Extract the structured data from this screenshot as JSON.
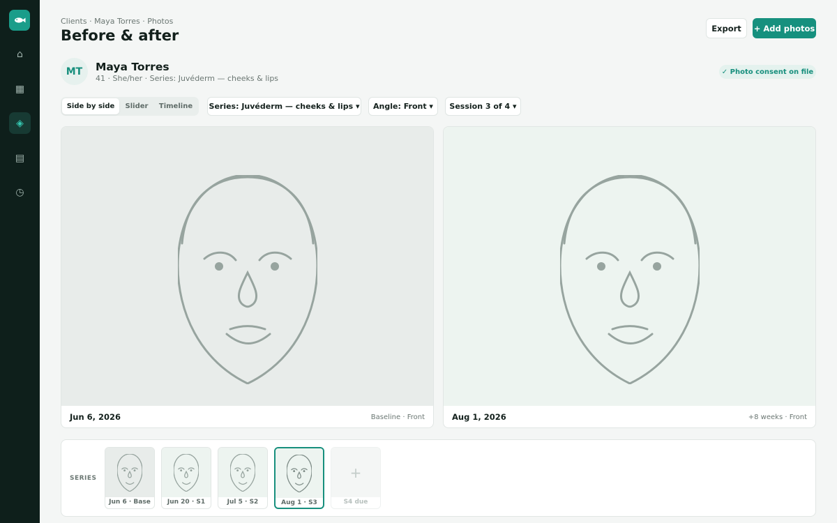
{
  "nav": {
    "logo": "fish-logo",
    "items": [
      {
        "icon": "home-icon",
        "glyph": "⌂"
      },
      {
        "icon": "calendar-icon",
        "glyph": "▦"
      },
      {
        "icon": "photos-icon",
        "glyph": "◈"
      },
      {
        "icon": "records-icon",
        "glyph": "▤"
      },
      {
        "icon": "history-icon",
        "glyph": "◷"
      }
    ],
    "active_index": 2
  },
  "header": {
    "breadcrumb": "Clients · Maya Torres · Photos",
    "title": "Before & after",
    "export_label": "Export",
    "add_label": "+ Add photos"
  },
  "client": {
    "initials": "MT",
    "name": "Maya Torres",
    "meta": "41 · She/her · Series: Juvéderm — cheeks & lips",
    "consent": "✓ Photo consent on file"
  },
  "view_modes": [
    "Side by side",
    "Slider",
    "Timeline"
  ],
  "active_view": "Side by side",
  "filters": {
    "series": "Series: Juvéderm — cheeks & lips ▾",
    "angle": "Angle: Front ▾",
    "session": "Session 3 of 4 ▾"
  },
  "before": {
    "date": "Jun 6, 2026",
    "note": "Baseline · Front"
  },
  "after": {
    "date": "Aug 1, 2026",
    "note": "+8 weeks · Front"
  },
  "series_strip": {
    "label": "SERIES",
    "thumbs": [
      {
        "caption": "Jun 6 · Base"
      },
      {
        "caption": "Jun 20 · S1"
      },
      {
        "caption": "Jul 5 · S2"
      },
      {
        "caption": "Aug 1 · S3"
      },
      {
        "caption": "S4 due"
      }
    ],
    "empty_glyph": "+"
  },
  "colors": {
    "accent": "#16907e",
    "sidebar": "#0e1f1b",
    "before_bg": "#e8ecea",
    "after_bg": "#edf4f0",
    "face_stroke": "#97a49f"
  }
}
